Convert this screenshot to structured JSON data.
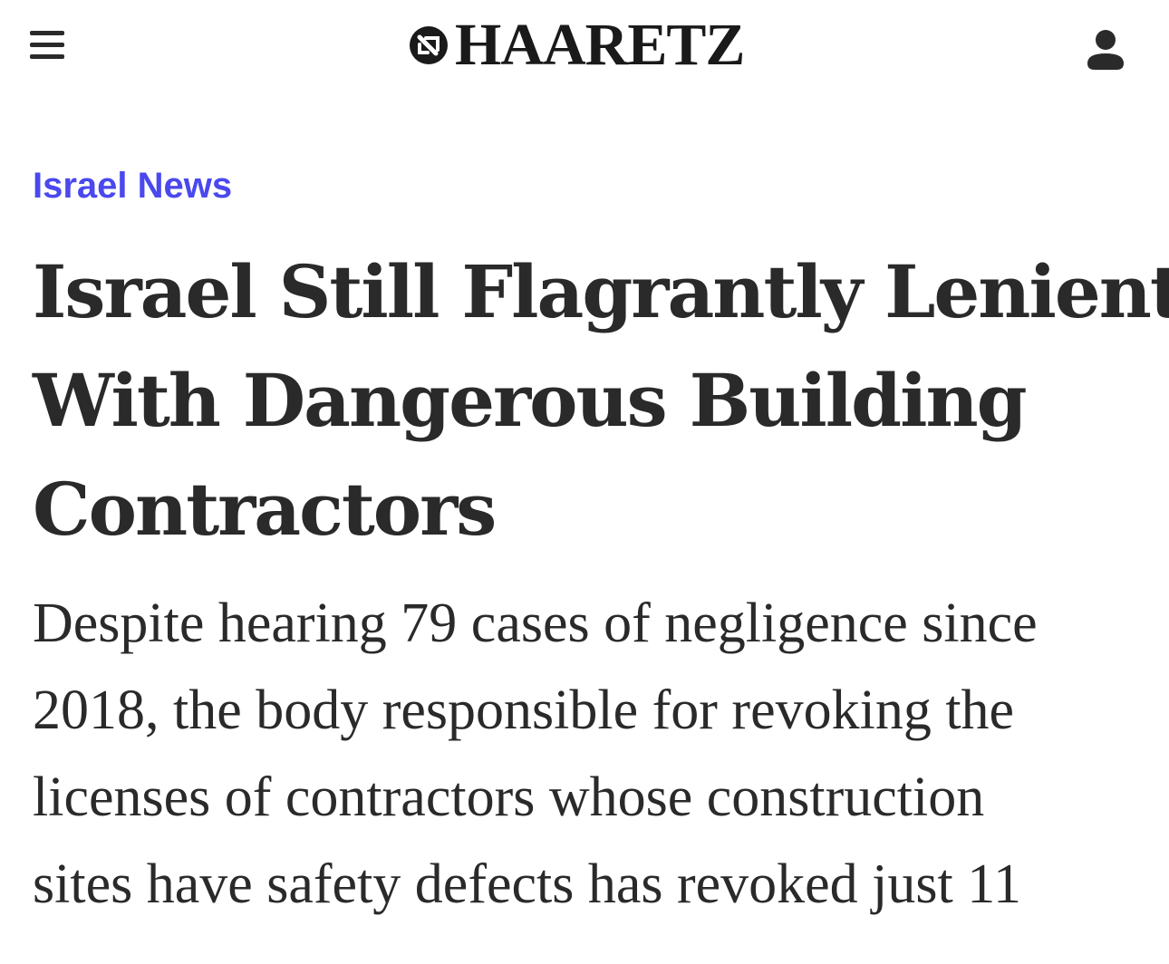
{
  "header": {
    "menu_icon": "hamburger-menu-icon",
    "logo_text": "HAARETZ",
    "logo_icon": "haaretz-mark-icon",
    "user_icon": "user-account-icon"
  },
  "article": {
    "section": "Israel News",
    "headline_lines": [
      "Israel Still Flagrantly Lenient",
      "With Dangerous Building",
      "Contractors"
    ],
    "subhead_lines": [
      "Despite hearing 79 cases of negligence since",
      "2018, the body responsible for revoking the",
      "licenses of contractors whose construction",
      "sites have safety defects has revoked just 11"
    ]
  },
  "colors": {
    "section_link": "#4a48ee",
    "text": "#2a2a2a"
  }
}
